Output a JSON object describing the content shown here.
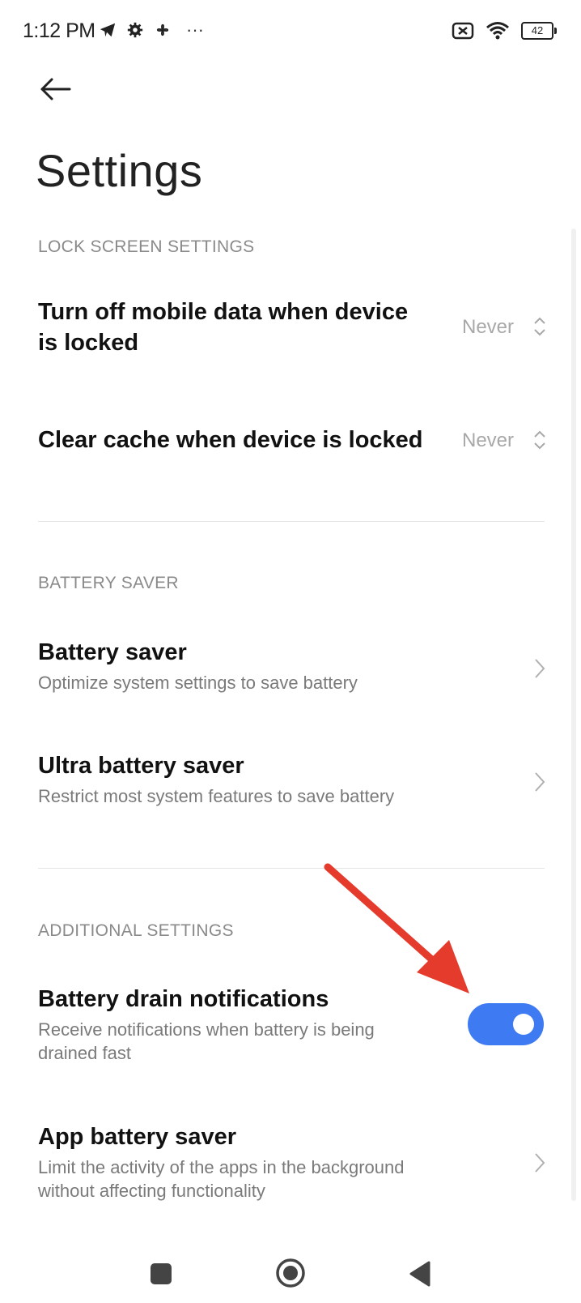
{
  "status_bar": {
    "time": "1:12 PM",
    "more": "···",
    "battery": "42"
  },
  "page": {
    "title": "Settings"
  },
  "sections": [
    {
      "header": "LOCK SCREEN SETTINGS"
    },
    {
      "header": "BATTERY SAVER"
    },
    {
      "header": "ADDITIONAL SETTINGS"
    }
  ],
  "lock_screen": {
    "mobile_data": {
      "title_line1": "Turn off mobile data when device",
      "title_line2": "is locked",
      "value": "Never"
    },
    "clear_cache": {
      "title": "Clear cache when device is locked",
      "value": "Never"
    }
  },
  "battery_saver": {
    "saver": {
      "title": "Battery saver",
      "subtitle": "Optimize system settings to save battery"
    },
    "ultra": {
      "title": "Ultra battery saver",
      "subtitle": "Restrict most system features to save battery"
    }
  },
  "additional": {
    "drain": {
      "title": "Battery drain notifications",
      "subtitle_line1": "Receive notifications when battery is being",
      "subtitle_line2": "drained fast",
      "enabled": true
    },
    "app_saver": {
      "title": "App battery saver",
      "subtitle_line1": "Limit the activity of the apps in the background",
      "subtitle_line2": "without affecting functionality"
    }
  },
  "colors": {
    "accent": "#3e7bf2",
    "annotation_arrow": "#e53b2c"
  },
  "icons": [
    "telegram-icon",
    "gear-icon",
    "fan-icon",
    "more-icon",
    "sim-off-icon",
    "wifi-icon",
    "battery-icon",
    "back-arrow-icon",
    "chevron-right-icon",
    "up-down-icon",
    "recents-icon",
    "home-icon",
    "back-icon"
  ]
}
